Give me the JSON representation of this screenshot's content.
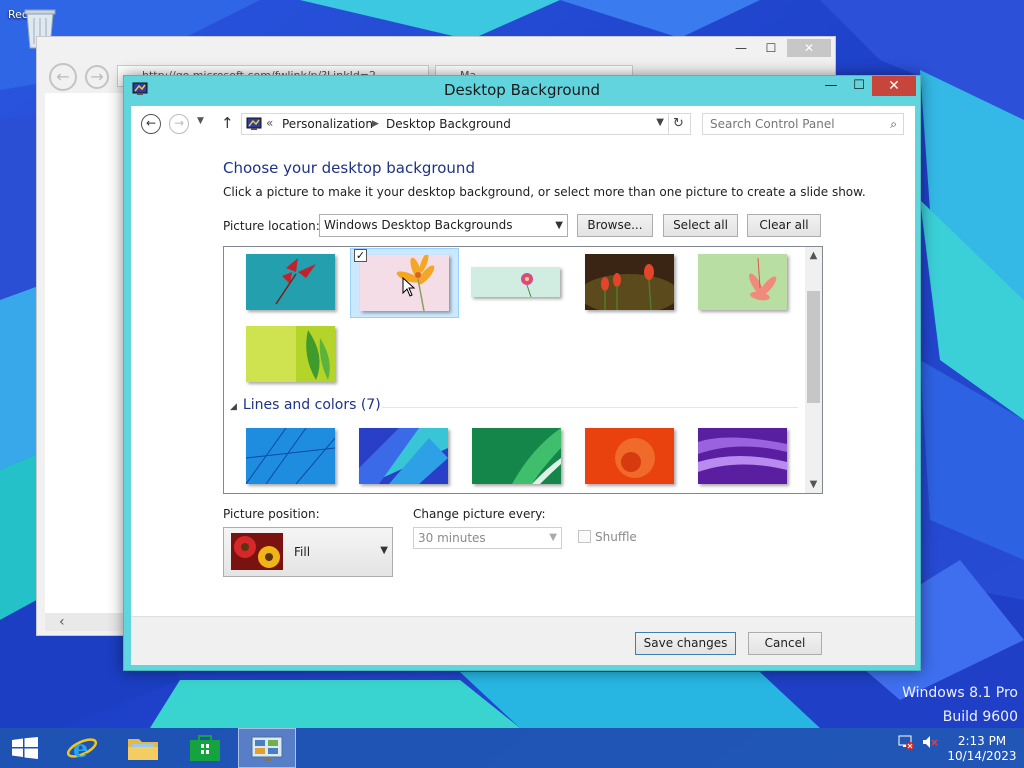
{
  "desktop": {
    "recycle_bin_label": "Recyc",
    "watermark_edition": "Windows 8.1 Pro",
    "watermark_build": "Build 9600"
  },
  "browser": {
    "address": "http://go.microsoft.com/fwlink/p/?LinkId=2",
    "tab_title": "Ma"
  },
  "dialog": {
    "title": "Desktop Background",
    "controls": {
      "minimize": "—",
      "maximize": "☐",
      "close": "✕"
    },
    "nav": {
      "breadcrumb_sep": "«",
      "breadcrumb": [
        "Personalization",
        "Desktop Background"
      ],
      "search_placeholder": "Search Control Panel"
    },
    "heading": "Choose your desktop background",
    "description": "Click a picture to make it your desktop background, or select more than one picture to create a slide show.",
    "picture_location": {
      "label": "Picture location:",
      "value": "Windows Desktop Backgrounds"
    },
    "buttons": {
      "browse": "Browse...",
      "select_all": "Select all",
      "clear_all": "Clear all",
      "save": "Save changes",
      "cancel": "Cancel"
    },
    "gallery": {
      "group_title": "Lines and colors (7)",
      "selected_index": 1,
      "flowers": [
        "red-flower-teal",
        "orange-flower-pink",
        "pink-daisy-mint",
        "orange-tulips-dark",
        "pink-lily-green",
        "green-leaves-yellow"
      ],
      "lines": [
        "blue-lines",
        "teal-blue-fan",
        "green-ribbons",
        "orange-swirl",
        "purple-waves"
      ]
    },
    "picture_position": {
      "label": "Picture position:",
      "value": "Fill"
    },
    "change_interval": {
      "label": "Change picture every:",
      "value": "30 minutes"
    },
    "shuffle": {
      "label": "Shuffle",
      "checked": false
    }
  },
  "taskbar": {
    "time": "2:13 PM",
    "date": "10/14/2023",
    "pinned": [
      "start-button",
      "internet-explorer",
      "file-explorer",
      "store",
      "control-panel"
    ]
  },
  "colors": {
    "accent": "#62d4dd",
    "heading": "#1e3287",
    "close_button": "#c7463c"
  }
}
